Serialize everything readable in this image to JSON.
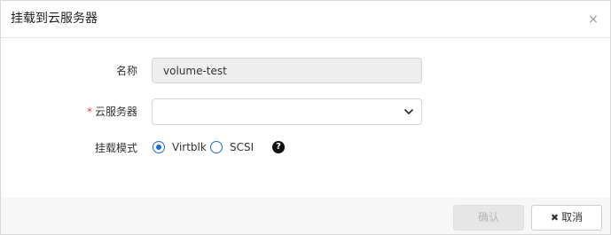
{
  "dialog": {
    "title": "挂载到云服务器",
    "close_glyph": "×"
  },
  "form": {
    "name_label": "名称",
    "name_value": "volume-test",
    "server_required_mark": "*",
    "server_label": "云服务器",
    "server_value": "",
    "mode_label": "挂载模式",
    "mode_options": [
      {
        "label": "Virtblk",
        "checked": true
      },
      {
        "label": "SCSI",
        "checked": false
      }
    ],
    "help_glyph": "?"
  },
  "footer": {
    "confirm_label": "确认",
    "cancel_glyph": "✖",
    "cancel_label": "取消"
  },
  "colors": {
    "accent": "#1e6bd6",
    "required": "#e4393c",
    "disabled_text": "#b5b5b5"
  }
}
